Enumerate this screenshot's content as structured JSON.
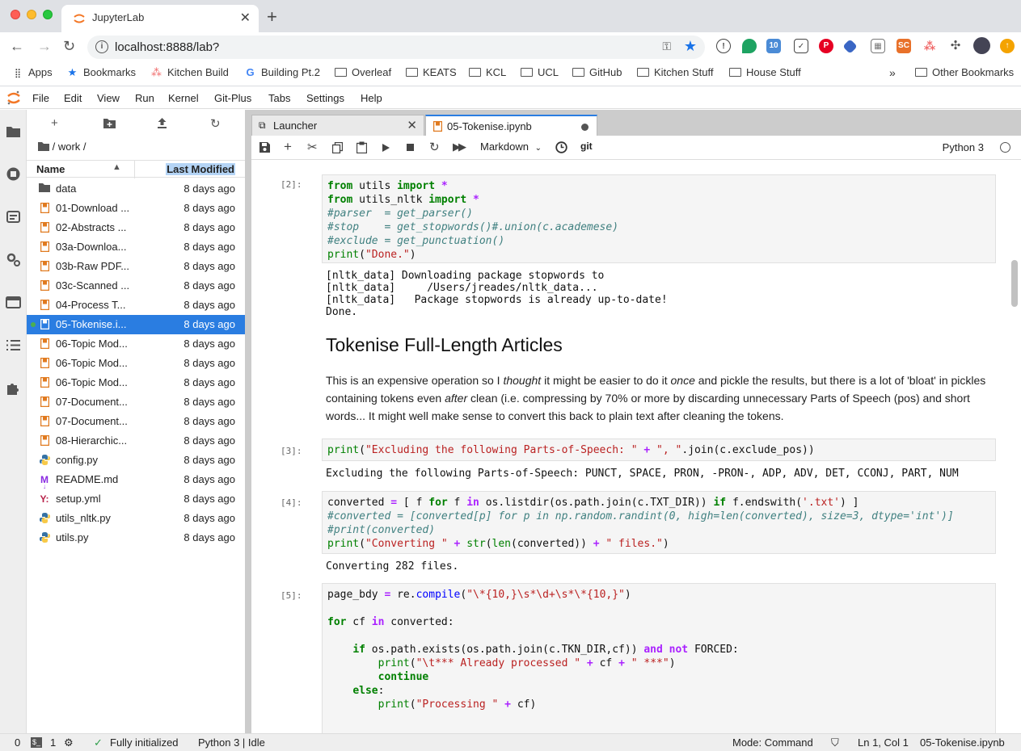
{
  "browser": {
    "tab_title": "JupyterLab",
    "url": "localhost:8888/lab?",
    "bookmarks": [
      {
        "label": "Apps",
        "icon": "apps-grid-icon"
      },
      {
        "label": "Bookmarks",
        "icon": "star-icon"
      },
      {
        "label": "Kitchen Build",
        "icon": "asana-icon"
      },
      {
        "label": "Building Pt.2",
        "icon": "google-icon"
      },
      {
        "label": "Overleaf",
        "icon": "folder-icon"
      },
      {
        "label": "KEATS",
        "icon": "folder-icon"
      },
      {
        "label": "KCL",
        "icon": "folder-icon"
      },
      {
        "label": "UCL",
        "icon": "folder-icon"
      },
      {
        "label": "GitHub",
        "icon": "folder-icon"
      },
      {
        "label": "Kitchen Stuff",
        "icon": "folder-icon"
      },
      {
        "label": "House Stuff",
        "icon": "folder-icon"
      }
    ],
    "overflow": "»",
    "other_bookmarks": "Other Bookmarks"
  },
  "menubar": [
    "File",
    "Edit",
    "View",
    "Run",
    "Kernel",
    "Git-Plus",
    "Tabs",
    "Settings",
    "Help"
  ],
  "filebrowser": {
    "breadcrumb": "/ work /",
    "col_name": "Name",
    "col_modified": "Last Modified",
    "files": [
      {
        "name": "data",
        "date": "8 days ago",
        "type": "folder"
      },
      {
        "name": "01-Download ...",
        "date": "8 days ago",
        "type": "notebook"
      },
      {
        "name": "02-Abstracts ...",
        "date": "8 days ago",
        "type": "notebook"
      },
      {
        "name": "03a-Downloa...",
        "date": "8 days ago",
        "type": "notebook"
      },
      {
        "name": "03b-Raw PDF...",
        "date": "8 days ago",
        "type": "notebook"
      },
      {
        "name": "03c-Scanned ...",
        "date": "8 days ago",
        "type": "notebook"
      },
      {
        "name": "04-Process T...",
        "date": "8 days ago",
        "type": "notebook"
      },
      {
        "name": "05-Tokenise.i...",
        "date": "8 days ago",
        "type": "notebook",
        "selected": true
      },
      {
        "name": "06-Topic Mod...",
        "date": "8 days ago",
        "type": "notebook"
      },
      {
        "name": "06-Topic Mod...",
        "date": "8 days ago",
        "type": "notebook"
      },
      {
        "name": "06-Topic Mod...",
        "date": "8 days ago",
        "type": "notebook"
      },
      {
        "name": "07-Document...",
        "date": "8 days ago",
        "type": "notebook"
      },
      {
        "name": "07-Document...",
        "date": "8 days ago",
        "type": "notebook"
      },
      {
        "name": "08-Hierarchic...",
        "date": "8 days ago",
        "type": "notebook"
      },
      {
        "name": "config.py",
        "date": "8 days ago",
        "type": "python"
      },
      {
        "name": "README.md",
        "date": "8 days ago",
        "type": "markdown"
      },
      {
        "name": "setup.yml",
        "date": "8 days ago",
        "type": "yaml"
      },
      {
        "name": "utils_nltk.py",
        "date": "8 days ago",
        "type": "python"
      },
      {
        "name": "utils.py",
        "date": "8 days ago",
        "type": "python"
      }
    ]
  },
  "doctabs": {
    "launcher": "Launcher",
    "notebook": "05-Tokenise.ipynb"
  },
  "notebook_toolbar": {
    "cell_type": "Markdown",
    "git": "git",
    "kernel": "Python 3"
  },
  "cells": {
    "c2_prompt": "[2]:",
    "c2_out": "[nltk_data] Downloading package stopwords to\n[nltk_data]     /Users/jreades/nltk_data...\n[nltk_data]   Package stopwords is already up-to-date!\nDone.",
    "md_heading": "Tokenise Full-Length Articles",
    "md_p_1": "This is an expensive operation so I ",
    "md_p_em1": "thought",
    "md_p_2": " it might be easier to do it ",
    "md_p_em2": "once",
    "md_p_3": " and pickle the results, but there is a lot of 'bloat' in pickles containing tokens even ",
    "md_p_em3": "after",
    "md_p_4": " clean (i.e. compressing by 70% or more by discarding unnecessary Parts of Speech (pos) and short words... It might well make sense to convert this back to plain text after cleaning the tokens.",
    "c3_prompt": "[3]:",
    "c3_out": "Excluding the following Parts-of-Speech: PUNCT, SPACE, PRON, -PRON-, ADP, ADV, DET, CCONJ, PART, NUM",
    "c4_prompt": "[4]:",
    "c4_out": "Converting 282 files.",
    "c5_prompt": "[5]:"
  },
  "statusbar": {
    "count_left": "0",
    "terminals": "1",
    "init": "Fully initialized",
    "kernel_state": "Python 3 | Idle",
    "mode": "Mode: Command",
    "position": "Ln 1, Col 1",
    "filename": "05-Tokenise.ipynb"
  },
  "colors": {
    "accent": "#2a7de1",
    "notebook_icon": "#e07a1f",
    "python_icon": "#3572a5"
  }
}
